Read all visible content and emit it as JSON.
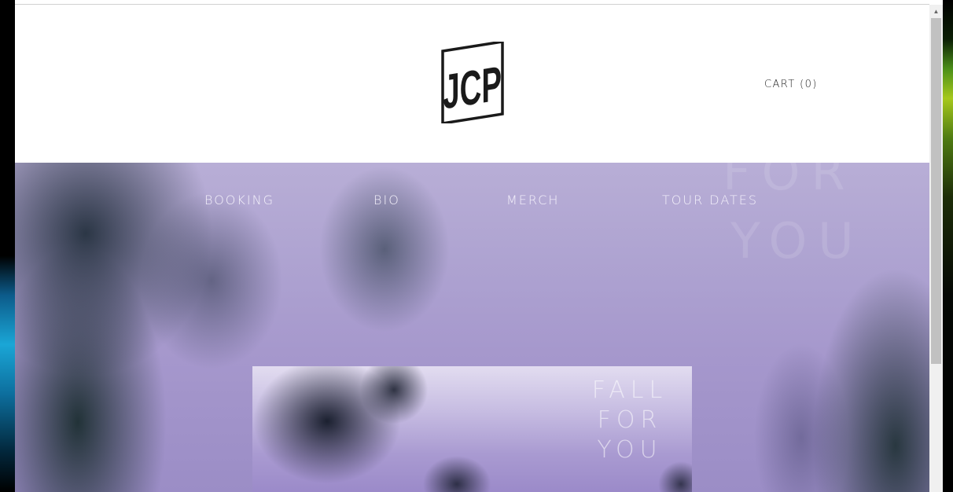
{
  "header": {
    "logo_text": "JCP",
    "cart_label": "CART (0)"
  },
  "nav": {
    "items": [
      {
        "label": "BOOKING"
      },
      {
        "label": "BIO"
      },
      {
        "label": "MERCH"
      },
      {
        "label": "TOUR DATES"
      }
    ]
  },
  "hero": {
    "background_text": [
      "FOR",
      "YOU"
    ],
    "album": {
      "title_lines": [
        "FALL",
        "FOR",
        "YOU"
      ]
    }
  },
  "colors": {
    "logo": "#1a1a1a",
    "hero_tint": "#a597cc",
    "nav_text": "#f4f1fb"
  }
}
